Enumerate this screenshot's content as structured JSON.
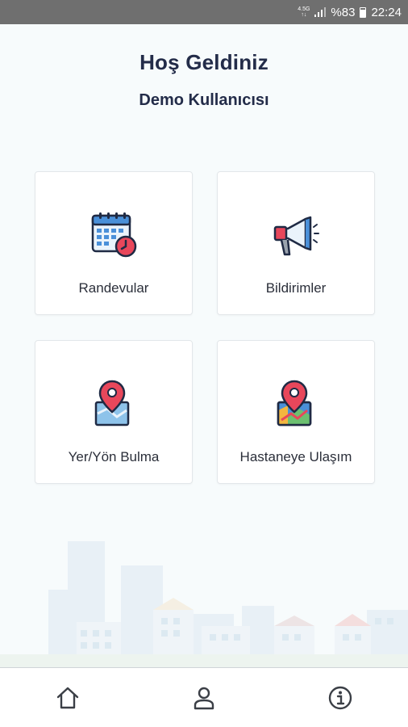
{
  "status_bar": {
    "network_top": "4.5G",
    "network_bottom": "↑↓",
    "battery": "%83",
    "time": "22:24"
  },
  "header": {
    "title": "Hoş Geldiniz",
    "subtitle": "Demo Kullanıcısı"
  },
  "cards": [
    {
      "label": "Randevular",
      "icon": "calendar-clock-icon"
    },
    {
      "label": "Bildirimler",
      "icon": "megaphone-icon"
    },
    {
      "label": "Yer/Yön Bulma",
      "icon": "map-pin-icon"
    },
    {
      "label": "Hastaneye Ulaşım",
      "icon": "map-route-icon"
    }
  ],
  "bottom_nav": [
    {
      "name": "home",
      "icon": "home-icon"
    },
    {
      "name": "profile",
      "icon": "user-icon"
    },
    {
      "name": "info",
      "icon": "info-icon"
    }
  ],
  "colors": {
    "accent_red": "#e8475b",
    "navy": "#232c49",
    "icon_blue": "#4a90d9",
    "status_bar": "#6f6f6f"
  }
}
